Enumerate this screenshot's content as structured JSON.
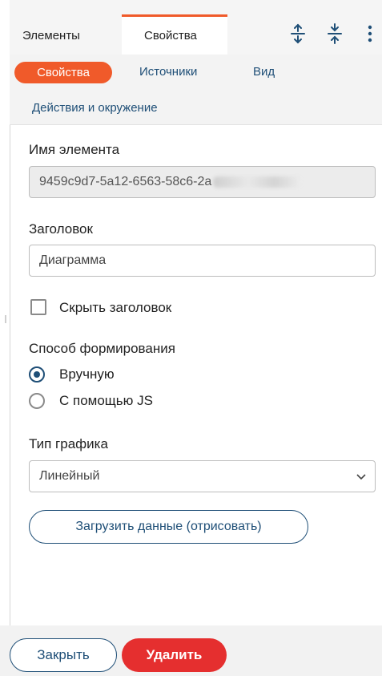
{
  "tabs": {
    "elements": "Элементы",
    "properties": "Свойства",
    "icons": [
      "expand-vertical-icon",
      "collapse-vertical-icon",
      "more-vertical-icon"
    ]
  },
  "subtabs": {
    "properties": "Свойства",
    "sources": "Источники",
    "view": "Вид",
    "actions": "Действия и окружение"
  },
  "form": {
    "element_name_label": "Имя элемента",
    "element_name_value": "9459c9d7-5a12-6563-58c6-2a",
    "title_label": "Заголовок",
    "title_value": "Диаграмма",
    "hide_title_label": "Скрыть заголовок",
    "hide_title_checked": false,
    "mode_label": "Способ формирования",
    "mode_options": [
      "Вручную",
      "С помощью JS"
    ],
    "mode_selected": "Вручную",
    "chart_type_label": "Тип графика",
    "chart_type_value": "Линейный",
    "load_button": "Загрузить данные (отрисовать)"
  },
  "footer": {
    "close": "Закрыть",
    "delete": "Удалить"
  },
  "colors": {
    "accent": "#f05a2a",
    "link": "#1f4f77",
    "danger": "#e52f2f"
  }
}
